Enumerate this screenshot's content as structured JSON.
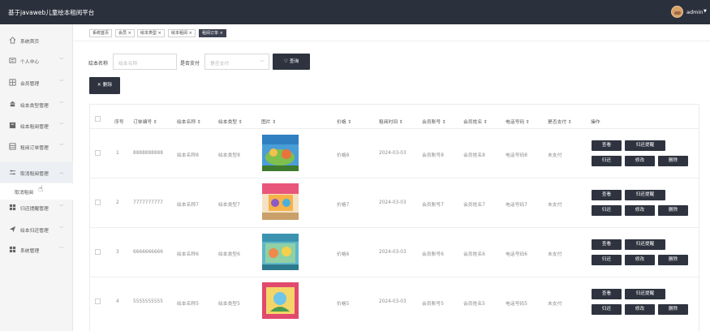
{
  "app": {
    "title": "基于javaweb儿童绘本租阅平台",
    "user": "admin"
  },
  "sidebar": {
    "items": [
      {
        "label": "系统首页",
        "icon": "home-icon"
      },
      {
        "label": "个人中心",
        "icon": "id-card-icon"
      },
      {
        "label": "会员管理",
        "icon": "grid-icon"
      },
      {
        "label": "绘本类型管理",
        "icon": "bank-icon"
      },
      {
        "label": "绘本租阅管理",
        "icon": "book-icon"
      },
      {
        "label": "租阅订单管理",
        "icon": "table-icon"
      },
      {
        "label": "取消租阅管理",
        "icon": "sliders-icon"
      },
      {
        "label": "归还提醒管理",
        "icon": "apps-icon"
      },
      {
        "label": "绘本归还管理",
        "icon": "send-icon"
      },
      {
        "label": "系统管理",
        "icon": "apps-icon"
      }
    ],
    "sub_item": "取消租阅"
  },
  "tabs": [
    "系统首页",
    "会员 ×",
    "绘本类型 ×",
    "绘本租阅 ×",
    "租阅订单 ×"
  ],
  "search": {
    "name_label": "绘本名称",
    "name_placeholder": "绘本名称",
    "pay_label": "是否支付",
    "pay_placeholder": "是否支付",
    "search_button": "查询",
    "delete_button": "删除"
  },
  "table": {
    "columns": [
      "序号",
      "订单编号 ⇕",
      "绘本名称 ⇕",
      "绘本类型 ⇕",
      "图片 ⇕",
      "价格 ⇕",
      "租阅时间 ⇕",
      "会员账号 ⇕",
      "会员姓名 ⇕",
      "电话号码 ⇕",
      "是否支付 ⇕",
      "操作"
    ],
    "rows": [
      {
        "index": "1",
        "order_no": "8888888888",
        "name": "绘本名称8",
        "type": "绘本类型8",
        "price": "价格8",
        "date": "2024-03-03",
        "account": "会员账号8",
        "member": "会员姓名8",
        "phone": "电话号码8",
        "paid": "未支付"
      },
      {
        "index": "2",
        "order_no": "7777777777",
        "name": "绘本名称7",
        "type": "绘本类型7",
        "price": "价格7",
        "date": "2024-03-03",
        "account": "会员账号7",
        "member": "会员姓名7",
        "phone": "电话号码7",
        "paid": "未支付"
      },
      {
        "index": "3",
        "order_no": "6666666666",
        "name": "绘本名称6",
        "type": "绘本类型6",
        "price": "价格6",
        "date": "2024-03-03",
        "account": "会员账号6",
        "member": "会员姓名6",
        "phone": "电话号码6",
        "paid": "未支付"
      },
      {
        "index": "4",
        "order_no": "5555555555",
        "name": "绘本名称5",
        "type": "绘本类型5",
        "price": "价格5",
        "date": "2024-03-03",
        "account": "会员账号5",
        "member": "会员姓名5",
        "phone": "电话号码5",
        "paid": "未支付"
      }
    ],
    "actions": {
      "view": "查看",
      "remind": "归还提醒",
      "return": "归还",
      "edit": "修改",
      "delete": "删除"
    }
  }
}
